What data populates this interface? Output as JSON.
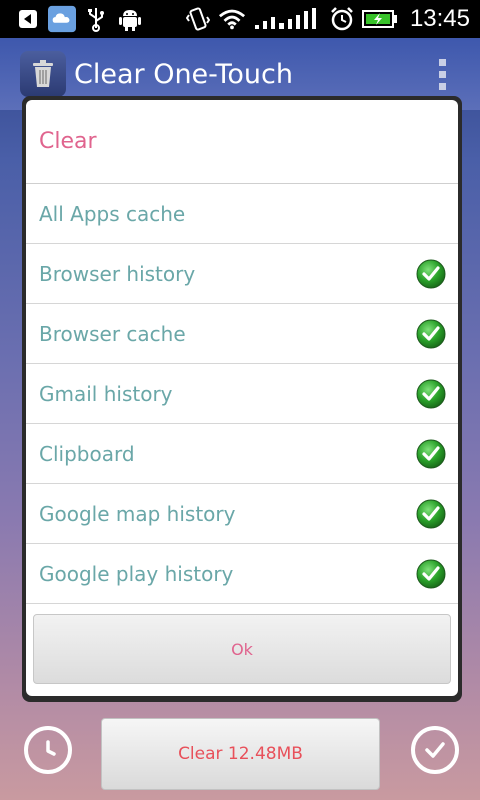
{
  "status_bar": {
    "time": "13:45",
    "icons": [
      "back-notification-icon",
      "cloud-icon",
      "usb-icon",
      "android-debug-icon",
      "vibrate-icon",
      "wifi-icon",
      "signal-icon",
      "alarm-icon",
      "battery-charging-icon"
    ]
  },
  "app": {
    "title": "Clear One-Touch",
    "icon": "trash-can-icon"
  },
  "dialog": {
    "title": "Clear",
    "items": [
      {
        "label": "All Apps cache",
        "checked": false
      },
      {
        "label": "Browser history",
        "checked": true
      },
      {
        "label": "Browser cache",
        "checked": true
      },
      {
        "label": "Gmail history",
        "checked": true
      },
      {
        "label": "Clipboard",
        "checked": true
      },
      {
        "label": "Google map history",
        "checked": true
      },
      {
        "label": "Google play history",
        "checked": true
      }
    ],
    "ok_label": "Ok"
  },
  "bottom_bar": {
    "clear_label": "Clear 12.48MB",
    "left_icon": "clock-icon",
    "right_icon": "checkmark-circle-icon"
  },
  "colors": {
    "accent_pink": "#e0648e",
    "item_teal": "#6aa7a8",
    "clear_red": "#e8505a"
  }
}
